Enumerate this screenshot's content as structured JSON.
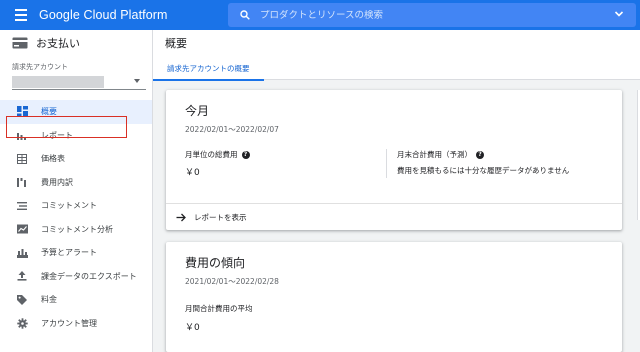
{
  "topbar": {
    "brand": "Google Cloud Platform",
    "search_placeholder": "プロダクトとリソースの検索",
    "color": "#1a73e8"
  },
  "sidebar": {
    "title": "お支払い",
    "account_label": "請求先アカウント",
    "items": [
      {
        "label": "概要",
        "icon": "dashboard-icon",
        "active": true
      },
      {
        "label": "レポート",
        "icon": "bar-chart-icon",
        "active": false,
        "highlighted": true
      },
      {
        "label": "価格表",
        "icon": "table-icon",
        "active": false
      },
      {
        "label": "費用内訳",
        "icon": "cost-breakdown-icon",
        "active": false
      },
      {
        "label": "コミットメント",
        "icon": "list-icon",
        "active": false
      },
      {
        "label": "コミットメント分析",
        "icon": "analysis-icon",
        "active": false
      },
      {
        "label": "予算とアラート",
        "icon": "budget-icon",
        "active": false
      },
      {
        "label": "課金データのエクスポート",
        "icon": "export-icon",
        "active": false
      },
      {
        "label": "料金",
        "icon": "tag-icon",
        "active": false
      },
      {
        "label": "アカウント管理",
        "icon": "gear-icon",
        "active": false
      }
    ]
  },
  "main": {
    "title": "概要",
    "tab": "請求先アカウントの概要",
    "card1": {
      "title": "今月",
      "range": "2022/02/01～2022/02/07",
      "metric1_label": "月単位の総費用",
      "metric1_value": "￥0",
      "metric2_label": "月末合計費用（予測）",
      "metric2_note": "費用を見積もるには十分な履歴データがありません",
      "footer_link": "レポートを表示"
    },
    "card2": {
      "title": "費用の傾向",
      "range": "2021/02/01～2022/02/28",
      "avg_label": "月間合計費用の平均",
      "avg_value": "￥0"
    }
  }
}
